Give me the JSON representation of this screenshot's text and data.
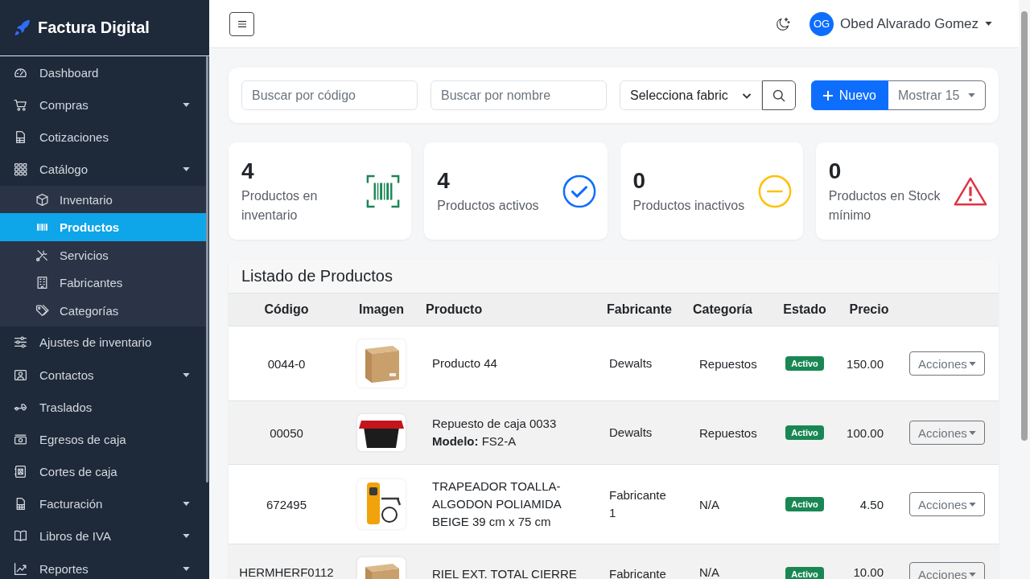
{
  "sidebar": {
    "brand": "Factura Digital",
    "items": [
      {
        "kind": "link",
        "label": "Dashboard",
        "selected": false
      },
      {
        "kind": "dropdown",
        "label": "Compras",
        "selected": false
      },
      {
        "kind": "link",
        "label": "Cotizaciones",
        "selected": false
      },
      {
        "kind": "dropdown",
        "label": "Catálogo",
        "selected": false,
        "expanded": true,
        "children": [
          {
            "label": "Inventario",
            "selected": false
          },
          {
            "label": "Productos",
            "selected": true
          },
          {
            "label": "Servicios",
            "selected": false
          },
          {
            "label": "Fabricantes",
            "selected": false
          },
          {
            "label": "Categorías",
            "selected": false
          }
        ]
      },
      {
        "kind": "link",
        "label": "Ajustes de inventario",
        "selected": false
      },
      {
        "kind": "dropdown",
        "label": "Contactos",
        "selected": false
      },
      {
        "kind": "link",
        "label": "Traslados",
        "selected": false
      },
      {
        "kind": "link",
        "label": "Egresos de caja",
        "selected": false
      },
      {
        "kind": "link",
        "label": "Cortes de caja",
        "selected": false
      },
      {
        "kind": "dropdown",
        "label": "Facturación",
        "selected": false
      },
      {
        "kind": "dropdown",
        "label": "Libros de IVA",
        "selected": false
      },
      {
        "kind": "dropdown",
        "label": "Reportes",
        "selected": false
      }
    ]
  },
  "topbar": {
    "user": {
      "initials": "OG",
      "name": "Obed Alvarado Gomez"
    }
  },
  "filters": {
    "code_search": {
      "placeholder": "Buscar por código"
    },
    "name_search": {
      "placeholder": "Buscar por nombre"
    },
    "manufacturer_select": {
      "value": "Selecciona fabric"
    },
    "new_button": {
      "label": "Nuevo"
    },
    "page_size_select": {
      "value": "Mostrar 15"
    }
  },
  "stats": [
    {
      "kind": "barcode",
      "value": "4",
      "label": "Productos en inventario"
    },
    {
      "kind": "check",
      "value": "4",
      "label": "Productos activos"
    },
    {
      "kind": "minus",
      "value": "0",
      "label": "Productos inactivos"
    },
    {
      "kind": "warning",
      "value": "0",
      "label": "Productos en Stock mínimo"
    }
  ],
  "table": {
    "title": "Listado de Productos",
    "columns": [
      "Código",
      "Imagen",
      "Producto",
      "Fabricante",
      "Categoría",
      "Estado",
      "Precio"
    ],
    "rows": [
      {
        "code": "0044-0",
        "image": {
          "kind": "box"
        },
        "product": "Producto 44",
        "manufacturer": "Dewalts",
        "category": "Repuestos",
        "status": "Activo",
        "price": "150.00",
        "action": "Acciones"
      },
      {
        "code": "00050",
        "image": {
          "kind": "crate"
        },
        "product": "Repuesto de caja 0033",
        "detail": "**Modelo:** FS2-A",
        "manufacturer": "Dewalts",
        "category": "Repuestos",
        "status": "Activo",
        "price": "100.00",
        "action": "Acciones"
      },
      {
        "code": "672495",
        "image": {
          "kind": "washer"
        },
        "product": "TRAPEADOR TOALLA-ALGODON POLIAMIDA BEIGE 39 cm x 75 cm",
        "manufacturer": "Fabricante 1",
        "category": "N/A",
        "status": "Activo",
        "price": "4.50",
        "action": "Acciones"
      },
      {
        "code": "HERMHERF0112",
        "image": {
          "kind": "box"
        },
        "product": "RIEL EXT. TOTAL CIERRE",
        "manufacturer": "Fabricante",
        "category": "N/A",
        "status": "Activo",
        "price": "10.00",
        "action": "Acciones"
      }
    ]
  }
}
